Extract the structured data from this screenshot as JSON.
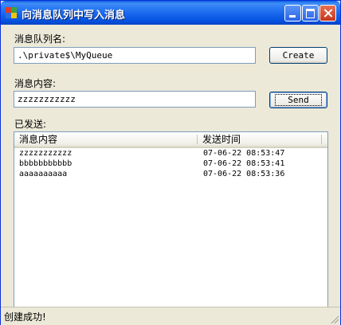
{
  "window": {
    "title": "向消息队列中写入消息"
  },
  "queue": {
    "label": "消息队列名:",
    "value": ".\\private$\\MyQueue",
    "create_button": "Create"
  },
  "message": {
    "label": "消息内容:",
    "value": "zzzzzzzzzzz",
    "send_button": "Send"
  },
  "sent": {
    "label": "已发送:",
    "columns": [
      "消息内容",
      "发送时间"
    ],
    "rows": [
      {
        "content": "zzzzzzzzzzz",
        "time": "07-06-22 08:53:47"
      },
      {
        "content": "bbbbbbbbbbb",
        "time": "07-06-22 08:53:41"
      },
      {
        "content": "aaaaaaaaaa",
        "time": "07-06-22 08:53:36"
      }
    ]
  },
  "status": {
    "text": "创建成功!"
  }
}
